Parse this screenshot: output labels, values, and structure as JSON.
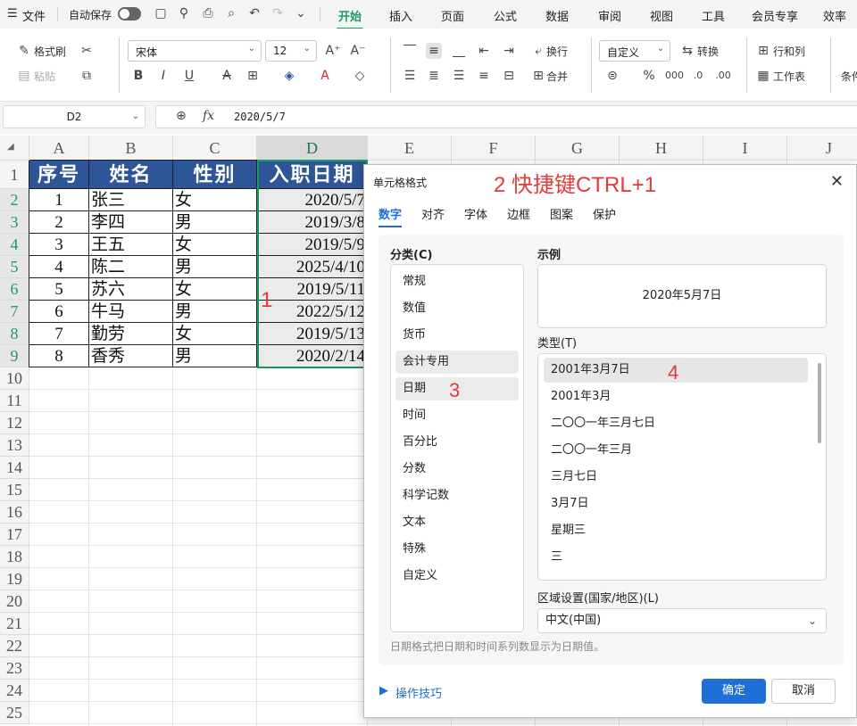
{
  "menubar": {
    "menu_label": "文件",
    "autosave_label": "自动保存",
    "tabs": [
      "开始",
      "插入",
      "页面",
      "公式",
      "数据",
      "审阅",
      "视图",
      "工具",
      "会员专享",
      "效率"
    ],
    "active_tab": "开始"
  },
  "ribbon": {
    "format_painter": "格式刷",
    "paste": "粘贴",
    "font_name": "宋体",
    "font_size": "12",
    "wrap": "换行",
    "merge": "合并",
    "number_format": "自定义",
    "convert": "转换",
    "row_col": "行和列",
    "worksheet": "工作表",
    "cond": "条件"
  },
  "formula_bar": {
    "cell_ref": "D2",
    "fx": "fx",
    "value": "2020/5/7"
  },
  "sheet": {
    "columns": [
      "A",
      "B",
      "C",
      "D",
      "E",
      "F",
      "G",
      "H",
      "I",
      "J"
    ],
    "rows": [
      "1",
      "2",
      "3",
      "4",
      "5",
      "6",
      "7",
      "8",
      "9",
      "10",
      "11",
      "12",
      "13",
      "14",
      "15",
      "16",
      "17",
      "18",
      "19",
      "20",
      "21",
      "22",
      "23",
      "24",
      "25"
    ],
    "headers": [
      "序号",
      "姓名",
      "性别",
      "入职日期"
    ],
    "data": [
      [
        "1",
        "张三",
        "女",
        "2020/5/7"
      ],
      [
        "2",
        "李四",
        "男",
        "2019/3/8"
      ],
      [
        "3",
        "王五",
        "女",
        "2019/5/9"
      ],
      [
        "4",
        "陈二",
        "男",
        "2025/4/10"
      ],
      [
        "5",
        "苏六",
        "女",
        "2019/5/11"
      ],
      [
        "6",
        "牛马",
        "男",
        "2022/5/12"
      ],
      [
        "7",
        "勤劳",
        "女",
        "2019/5/13"
      ],
      [
        "8",
        "香秀",
        "男",
        "2020/2/14"
      ]
    ]
  },
  "dialog": {
    "title": "单元格格式",
    "tabs": [
      "数字",
      "对齐",
      "字体",
      "边框",
      "图案",
      "保护"
    ],
    "category_label": "分类(C)",
    "categories": [
      "常规",
      "数值",
      "货币",
      "会计专用",
      "日期",
      "时间",
      "百分比",
      "分数",
      "科学记数",
      "文本",
      "特殊",
      "自定义"
    ],
    "sample_label": "示例",
    "sample_value": "2020年5月7日",
    "type_label": "类型(T)",
    "types": [
      "2001年3月7日",
      "2001年3月",
      "二〇〇一年三月七日",
      "二〇〇一年三月",
      "三月七日",
      "3月7日",
      "星期三",
      "三"
    ],
    "region_label": "区域设置(国家/地区)(L)",
    "region_value": "中文(中国)",
    "description": "日期格式把日期和时间系列数显示为日期值。",
    "tips_link": "操作技巧",
    "ok_label": "确定",
    "cancel_label": "取消"
  },
  "annotations": {
    "a1": "1",
    "a2": "2   快捷键CTRL+1",
    "a3": "3",
    "a4": "4"
  },
  "colors": {
    "accent_green": "#1c9b63",
    "header_blue": "#2e5597",
    "dialog_blue": "#1f6fd6",
    "annotation_red": "#e23b3b"
  }
}
